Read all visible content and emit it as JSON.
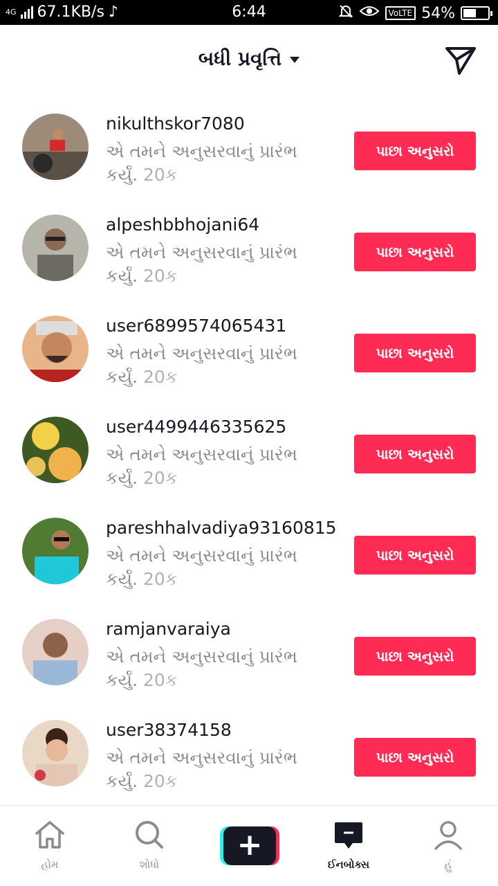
{
  "status_bar": {
    "network_type": "4G",
    "speed": "67.1KB/s",
    "time": "6:44",
    "volte": "VoLTE",
    "battery": "54%",
    "battery_level": 0.54
  },
  "header": {
    "title": "બધી પ્રવૃત્તિ"
  },
  "activity": [
    {
      "username": "nikulthskor7080",
      "action": "એ તમને અનુસરવાનું પ્રારંભ કર્યું.",
      "time": "20ક",
      "button": "પાછા અનુસરો"
    },
    {
      "username": "alpeshbbhojani64",
      "action": "એ તમને અનુસરવાનું પ્રારંભ કર્યું.",
      "time": "20ક",
      "button": "પાછા અનુસરો"
    },
    {
      "username": "user6899574065431",
      "action": "એ તમને અનુસરવાનું પ્રારંભ કર્યું.",
      "time": "20ક",
      "button": "પાછા અનુસરો"
    },
    {
      "username": "user4499446335625",
      "action": "એ તમને અનુસરવાનું પ્રારંભ કર્યું.",
      "time": "20ક",
      "button": "પાછા અનુસરો"
    },
    {
      "username": "pareshhalvadiya93160815",
      "action": "એ તમને અનુસરવાનું પ્રારંભ કર્યું.",
      "time": "20ક",
      "button": "પાછા અનુસરો"
    },
    {
      "username": "ramjanvaraiya",
      "action": "એ તમને અનુસરવાનું પ્રારંભ કર્યું.",
      "time": "20ક",
      "button": "પાછા અનુસરો"
    },
    {
      "username": "user38374158",
      "action": "એ તમને અનુસરવાનું પ્રારંભ કર્યું.",
      "time": "20ક",
      "button": "પાછા અનુસરો"
    }
  ],
  "bottom_nav": {
    "home": "હોમ",
    "search": "શોધો",
    "create": "+",
    "inbox": "ઈનબોક્સ",
    "me": "હું",
    "active": "inbox"
  },
  "colors": {
    "accent": "#fe2c55",
    "text_primary": "#161823",
    "text_secondary": "#8a8b91",
    "create_cyan": "#25f4ee"
  }
}
